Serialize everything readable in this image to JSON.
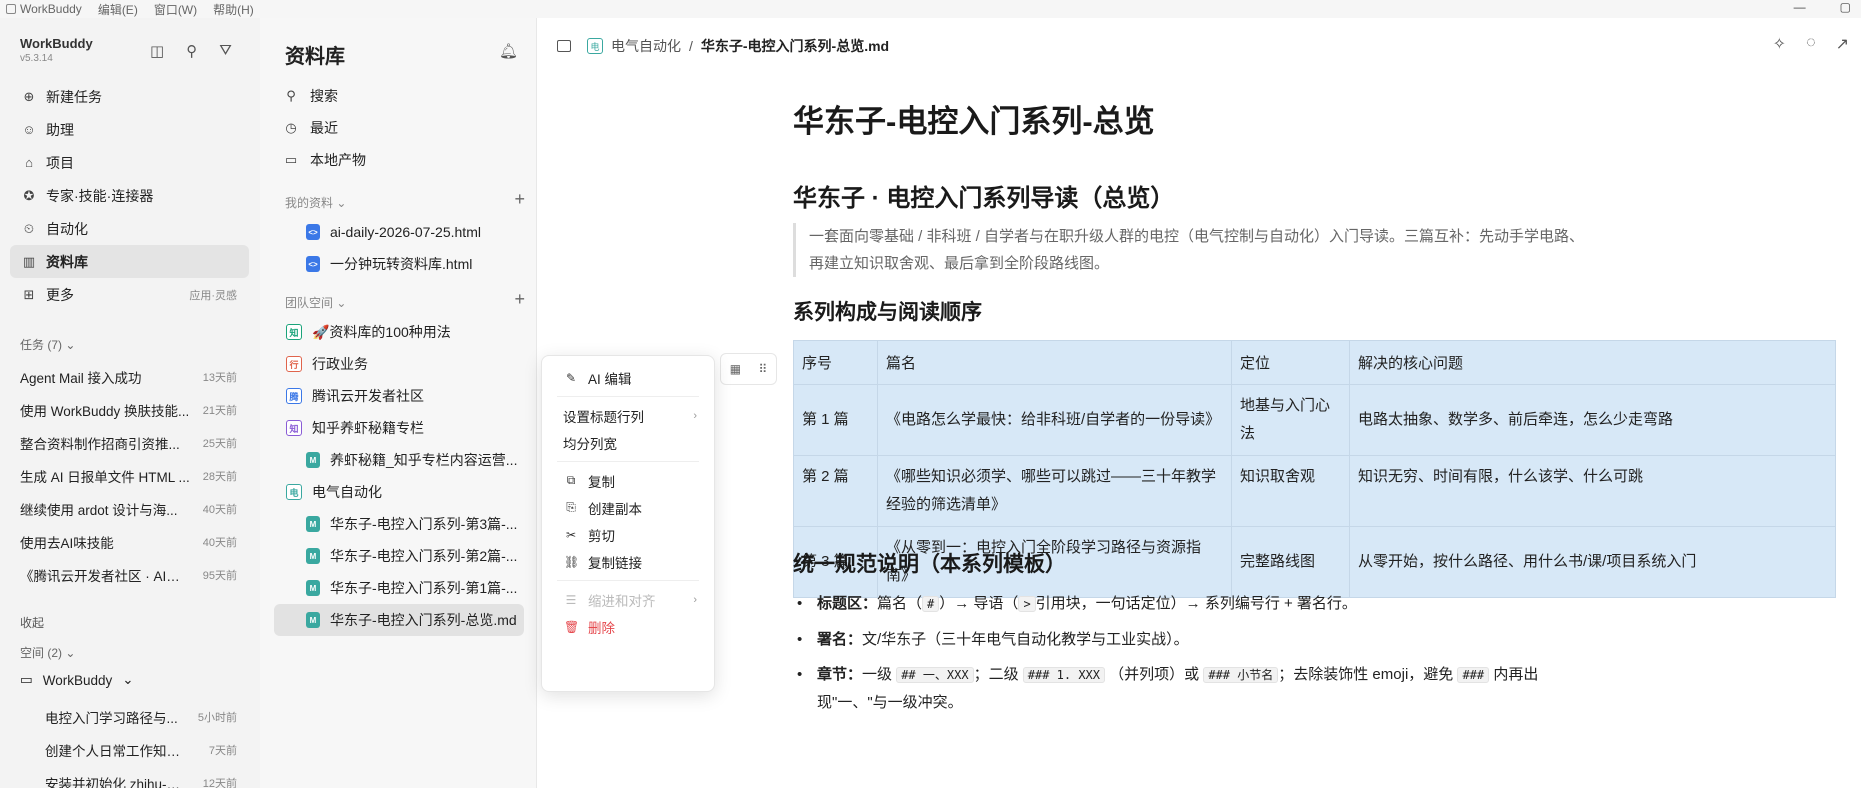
{
  "menubar": {
    "app": "WorkBuddy",
    "items": [
      "编辑(E)",
      "窗口(W)",
      "帮助(H)"
    ]
  },
  "sidebar": {
    "app_name": "WorkBuddy",
    "version": "v5.3.14",
    "nav": [
      {
        "label": "新建任务",
        "icon": "new-task-icon"
      },
      {
        "label": "助理",
        "icon": "assistant-icon"
      },
      {
        "label": "项目",
        "icon": "project-icon"
      },
      {
        "label": "专家·技能·连接器",
        "icon": "expert-icon"
      },
      {
        "label": "自动化",
        "icon": "automation-icon"
      },
      {
        "label": "资料库",
        "icon": "library-icon",
        "active": true
      },
      {
        "label": "更多",
        "icon": "more-icon",
        "extra": "应用·灵感"
      }
    ],
    "tasks_title": "任务 (7)",
    "tasks": [
      {
        "title": "Agent Mail 接入成功",
        "time": "13天前"
      },
      {
        "title": "使用 WorkBuddy 换肤技能...",
        "time": "21天前"
      },
      {
        "title": "整合资料制作招商引资推...",
        "time": "25天前"
      },
      {
        "title": "生成 AI 日报单文件 HTML ...",
        "time": "28天前"
      },
      {
        "title": "继续使用 ardot 设计与海...",
        "time": "40天前"
      },
      {
        "title": "使用去AI味技能",
        "time": "40天前"
      },
      {
        "title": "《腾讯云开发者社区 · AI大...",
        "time": "95天前"
      }
    ],
    "collapse_label": "收起",
    "spaces_title": "空间 (2)",
    "workspace": "WorkBuddy",
    "ws_tasks": [
      {
        "title": "电控入门学习路径与...",
        "time": "5小时前"
      },
      {
        "title": "创建个人日常工作知识库",
        "time": "7天前"
      },
      {
        "title": "安装并初始化 zhihu-cl...",
        "time": "12天前"
      }
    ]
  },
  "library": {
    "title": "资料库",
    "nav": [
      {
        "label": "搜索",
        "icon": "search-icon"
      },
      {
        "label": "最近",
        "icon": "clock-icon"
      },
      {
        "label": "本地产物",
        "icon": "folder-icon"
      }
    ],
    "my_section": "我的资料",
    "my_files": [
      {
        "name": "ai-daily-2026-07-25.html"
      },
      {
        "name": "一分钟玩转资料库.html"
      }
    ],
    "team_section": "团队空间",
    "team_items": [
      {
        "name": "🚀资料库的100种用法",
        "color": "#1aa37a",
        "glyph": "知"
      },
      {
        "name": "行政业务",
        "color": "#e0644c",
        "glyph": "行"
      },
      {
        "name": "腾讯云开发者社区",
        "color": "#3b78e7",
        "glyph": "腾"
      },
      {
        "name": "知乎养虾秘籍专栏",
        "color": "#8a5cd6",
        "glyph": "知"
      },
      {
        "name": "养虾秘籍_知乎专栏内容运营...",
        "sub": true
      },
      {
        "name": "电气自动化",
        "color": "#3aa8a0",
        "glyph": "电"
      },
      {
        "name": "华东子-电控入门系列-第3篇-...",
        "sub": true
      },
      {
        "name": "华东子-电控入门系列-第2篇-...",
        "sub": true
      },
      {
        "name": "华东子-电控入门系列-第1篇-...",
        "sub": true
      },
      {
        "name": "华东子-电控入门系列-总览.md",
        "sub": true,
        "active": true
      }
    ]
  },
  "breadcrumb": {
    "space": "电气自动化",
    "separator": "/",
    "current": "华东子-电控入门系列-总览.md"
  },
  "doc": {
    "h1": "华东子-电控入门系列-总览",
    "h2_intro": "华东子 · 电控入门系列导读（总览）",
    "quote_line1": "一套面向零基础 / 非科班 / 自学者与在职升级人群的电控（电气控制与自动化）入门导读。三篇互补：先动手学电路、",
    "quote_line2": "再建立知识取舍观、最后拿到全阶段路线图。",
    "h3_structure": "系列构成与阅读顺序",
    "table": {
      "headers": [
        "序号",
        "篇名",
        "定位",
        "解决的核心问题"
      ],
      "rows": [
        [
          "第 1 篇",
          "《电路怎么学最快：给非科班/自学者的一份导读》",
          "地基与入门心法",
          "电路太抽象、数学多、前后牵连，怎么少走弯路"
        ],
        [
          "第 2 篇",
          "《哪些知识必须学、哪些可以跳过——三十年教学经验的筛选清单》",
          "知识取舍观",
          "知识无穷、时间有限，什么该学、什么可跳"
        ],
        [
          "第 3 篇",
          "《从零到一：电控入门全阶段学习路径与资源指南》",
          "完整路线图",
          "从零开始，按什么路径、用什么书/课/项目系统入门"
        ]
      ]
    },
    "h3_norms": "统一规范说明（本系列模板）",
    "bullets": {
      "b1_label": "标题区：",
      "b1_text_a": "篇名（",
      "b1_code1": "#",
      "b1_text_b": "）→ 导语（",
      "b1_code2": ">",
      "b1_text_c": "引用块，一句话定位）→ 系列编号行 + 署名行。",
      "b2_label": "署名：",
      "b2_text": "文/华东子（三十年电气自动化教学与工业实战）。",
      "b3_label": "章节：",
      "b3_text_a": "一级",
      "b3_code1": "## 一、XXX",
      "b3_text_b": "；二级",
      "b3_code2": "### 1. XXX",
      "b3_text_c": "（并列项）或",
      "b3_code3": "### 小节名",
      "b3_text_d": "；去除装饰性 emoji，避免",
      "b3_code4": "###",
      "b3_text_e": "内再出",
      "b3_text_f": "现\"一、\"与一级冲突。"
    }
  },
  "context_menu": {
    "items": [
      {
        "label": "AI 编辑",
        "icon": "ai-edit-icon"
      },
      {
        "label": "设置标题行列",
        "submenu": true
      },
      {
        "label": "均分列宽"
      },
      {
        "label": "复制",
        "icon": "copy-icon"
      },
      {
        "label": "创建副本",
        "icon": "duplicate-icon"
      },
      {
        "label": "剪切",
        "icon": "scissors-icon"
      },
      {
        "label": "复制链接",
        "icon": "link-icon"
      },
      {
        "label": "缩进和对齐",
        "icon": "indent-icon",
        "disabled": true,
        "submenu": true
      },
      {
        "label": "删除",
        "icon": "trash-icon",
        "danger": true
      }
    ]
  }
}
